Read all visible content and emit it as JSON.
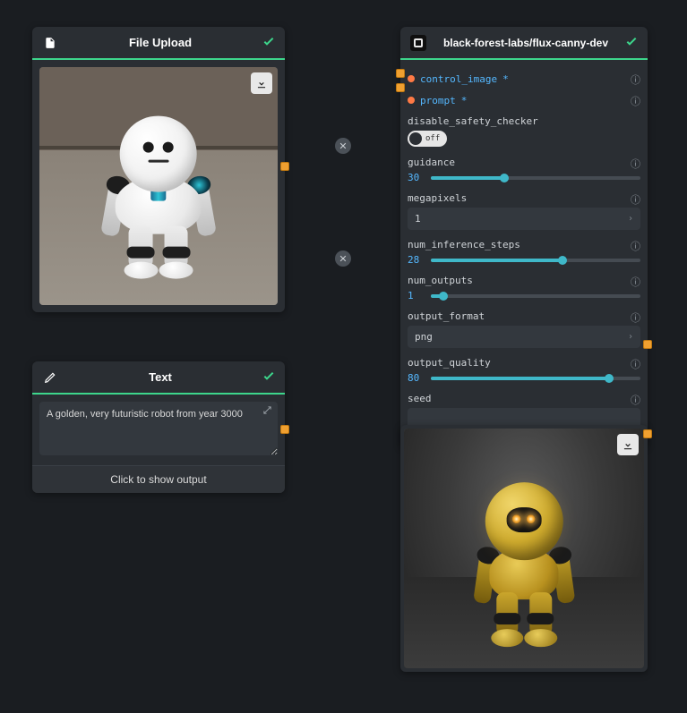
{
  "file_upload": {
    "title": "File Upload",
    "status": "success"
  },
  "text_node": {
    "title": "Text",
    "value": "A golden, very futuristic robot from year 3000",
    "show_output": "Click to show output",
    "status": "success"
  },
  "model_node": {
    "title": "black-forest-labs/flux-canny-dev",
    "status": "success",
    "params": {
      "control_image": {
        "label": "control_image",
        "required": "*",
        "linked": true
      },
      "prompt": {
        "label": "prompt",
        "required": "*",
        "linked": true
      },
      "disable_safety_checker": {
        "label": "disable_safety_checker",
        "value": "off"
      },
      "guidance": {
        "label": "guidance",
        "value": 30,
        "fill_pct": 35
      },
      "megapixels": {
        "label": "megapixels",
        "value": "1"
      },
      "num_inference_steps": {
        "label": "num_inference_steps",
        "value": 28,
        "fill_pct": 63
      },
      "num_outputs": {
        "label": "num_outputs",
        "value": 1,
        "fill_pct": 6
      },
      "output_format": {
        "label": "output_format",
        "value": "png"
      },
      "output_quality": {
        "label": "output_quality",
        "value": 80,
        "fill_pct": 85
      },
      "seed": {
        "label": "seed",
        "value": ""
      }
    }
  },
  "colors": {
    "accent_green": "#3dd68c",
    "accent_cyan": "#3fb8c9",
    "link_blue": "#55b8ff",
    "port_orange": "#f0a030"
  }
}
